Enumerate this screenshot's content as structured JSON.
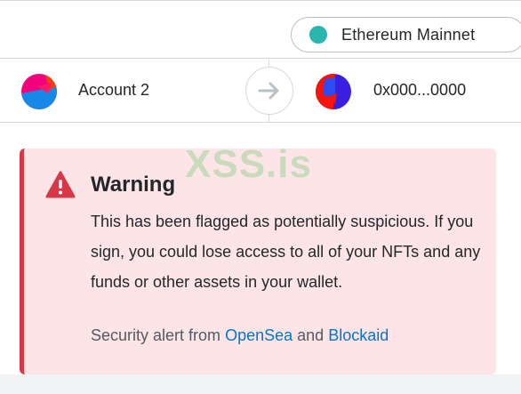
{
  "network": {
    "label": "Ethereum Mainnet",
    "dot_color": "#29b6af"
  },
  "accounts": {
    "from": {
      "name": "Account 2",
      "avatar_icon": "jazzicon-avatar"
    },
    "to": {
      "address": "0x000...0000",
      "avatar_icon": "jazzicon-avatar"
    },
    "arrow_icon": "arrow-right-icon"
  },
  "alert": {
    "icon": "warning-triangle-icon",
    "title": "Warning",
    "body": "This has been flagged as potentially suspicious. If you sign, you could lose access to all of your NFTs and any funds or other assets in your wallet.",
    "source_prefix": "Security alert from",
    "source_opensea": "OpenSea",
    "source_and": "and",
    "source_blockaid": "Blockaid",
    "accent_color": "#d73847",
    "background_color": "#fce4e7",
    "link_color": "#0376c9"
  },
  "watermark": "XSS.is"
}
